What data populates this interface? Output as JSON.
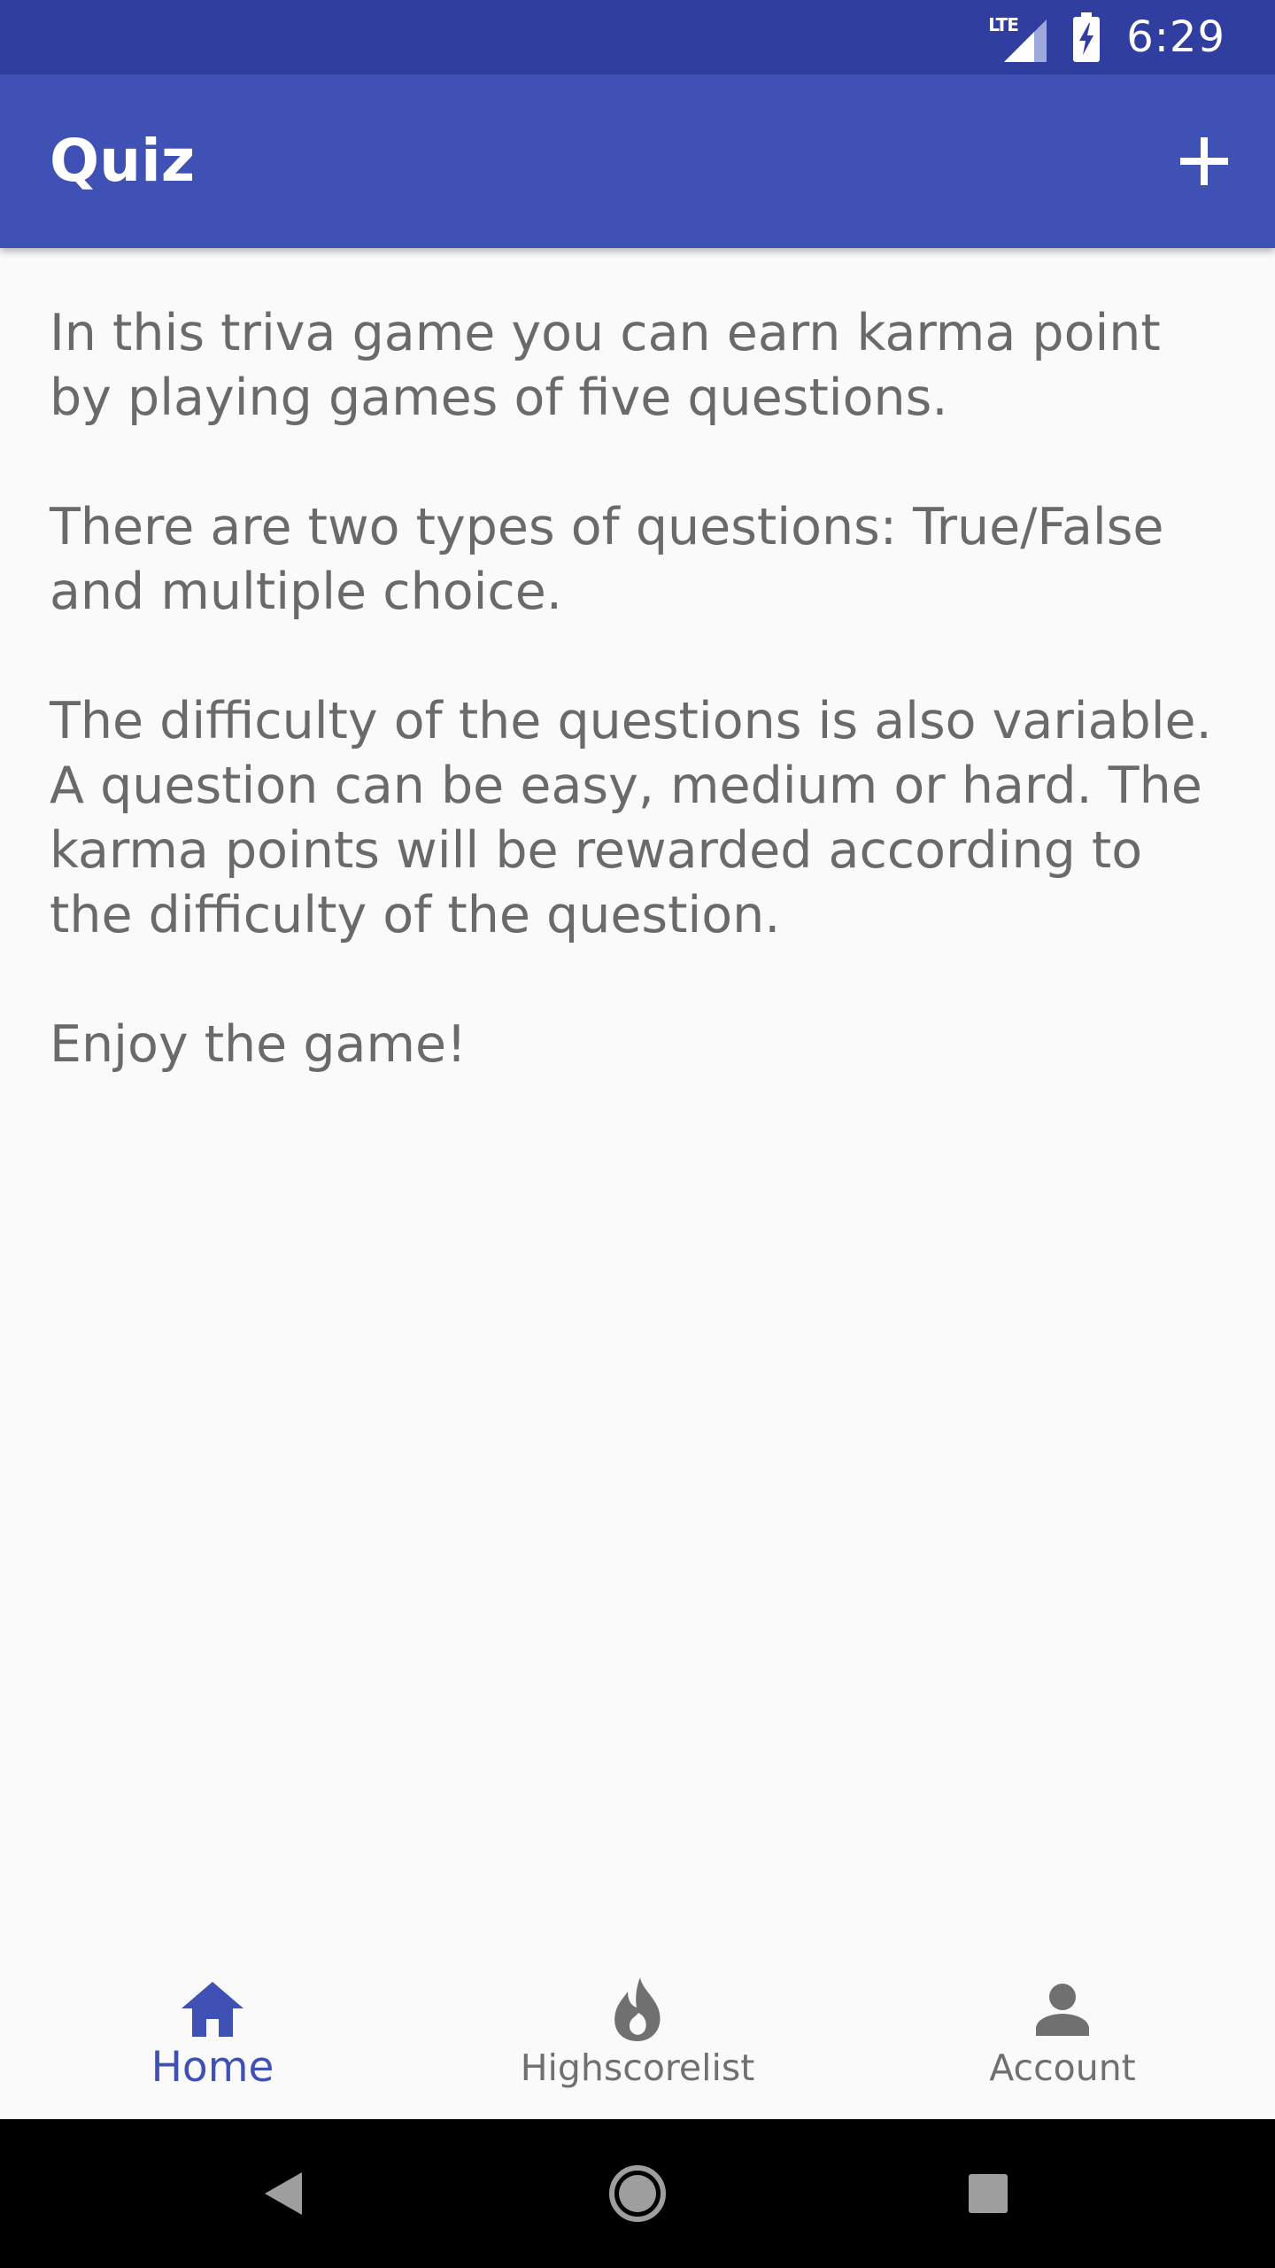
{
  "status_bar": {
    "network": "LTE",
    "time": "6:29",
    "icons": [
      "lte-signal-icon",
      "battery-charging-icon"
    ]
  },
  "app_bar": {
    "title": "Quiz",
    "action_icon": "add-icon"
  },
  "content": {
    "paragraphs": [
      "In this triva game you can earn karma point by playing games of five questions.",
      "There are two types of questions: True/False and multiple choice.",
      "The difficulty of the questions is also variable. A question can be easy, medium or hard. The karma points will be rewarded according to the difficulty of the question.",
      "Enjoy the game!"
    ]
  },
  "bottom_nav": {
    "items": [
      {
        "label": "Home",
        "icon": "home-icon",
        "active": true
      },
      {
        "label": "Highscorelist",
        "icon": "flame-icon",
        "active": false
      },
      {
        "label": "Account",
        "icon": "person-icon",
        "active": false
      }
    ]
  },
  "system_nav": {
    "icons": [
      "back-icon",
      "home-circle-icon",
      "recents-icon"
    ]
  },
  "colors": {
    "status_bar": "#303f9f",
    "app_bar": "#3f51b5",
    "active_nav": "#3f51b5",
    "inactive_nav": "#707070",
    "body_text": "#6a6a6a",
    "background": "#fafafa"
  }
}
